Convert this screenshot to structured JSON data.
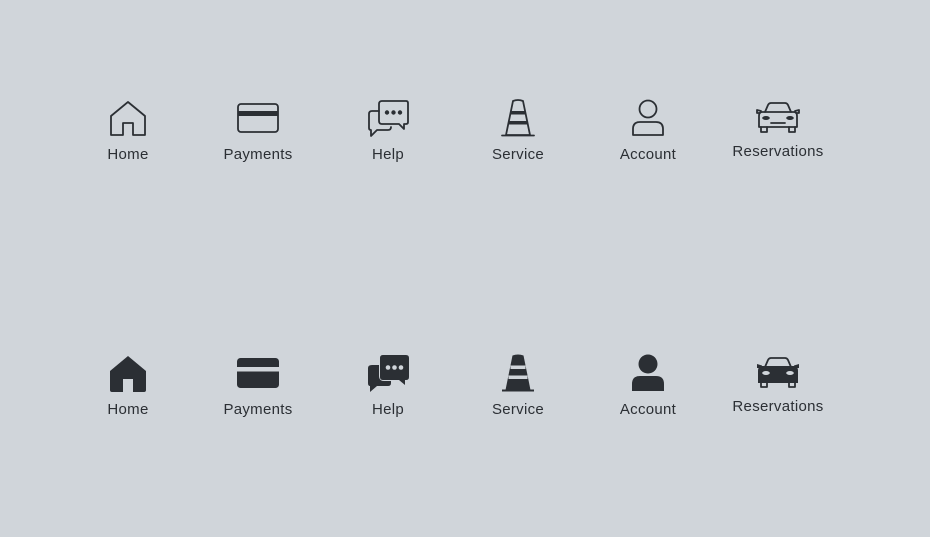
{
  "rows": [
    {
      "style": "outline",
      "items": [
        {
          "label": "Home",
          "icon": "home-icon"
        },
        {
          "label": "Payments",
          "icon": "credit-card-icon"
        },
        {
          "label": "Help",
          "icon": "chat-bubbles-icon"
        },
        {
          "label": "Service",
          "icon": "traffic-cone-icon"
        },
        {
          "label": "Account",
          "icon": "user-icon"
        },
        {
          "label": "Reservations",
          "icon": "car-icon"
        }
      ]
    },
    {
      "style": "filled",
      "items": [
        {
          "label": "Home",
          "icon": "home-icon"
        },
        {
          "label": "Payments",
          "icon": "credit-card-icon"
        },
        {
          "label": "Help",
          "icon": "chat-bubbles-icon"
        },
        {
          "label": "Service",
          "icon": "traffic-cone-icon"
        },
        {
          "label": "Account",
          "icon": "user-icon"
        },
        {
          "label": "Reservations",
          "icon": "car-icon"
        }
      ]
    }
  ],
  "colors": {
    "background": "#d0d5da",
    "icon": "#2b2f34",
    "text": "#2b2f34"
  }
}
